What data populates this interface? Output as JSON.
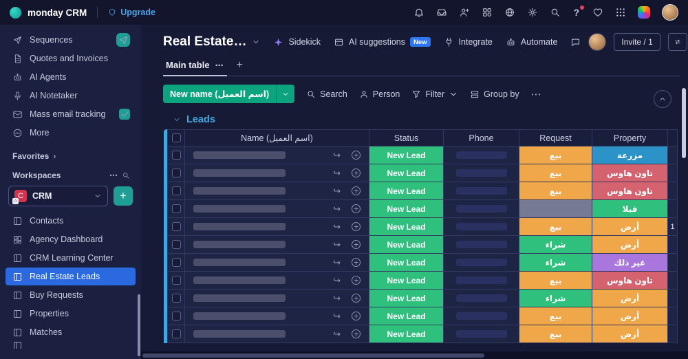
{
  "icons": {
    "more": "⋯",
    "plus": "+",
    "chevron_right": "›",
    "help": "?",
    "open_arrow": "↪"
  },
  "topbar": {
    "brand": "monday CRM",
    "upgrade_label": "Upgrade"
  },
  "sidebar": {
    "items": [
      "Sequences",
      "Quotes and Invoices",
      "AI Agents",
      "AI Notetaker",
      "Mass email tracking",
      "More"
    ],
    "favorites_label": "Favorites",
    "workspaces_label": "Workspaces",
    "workspace_name": "CRM",
    "workspace_items": [
      "Contacts",
      "Agency Dashboard",
      "CRM Learning Center",
      "Real Estate Leads",
      "Buy Requests",
      "Properties",
      "Matches"
    ],
    "selected_item": "Real Estate Leads"
  },
  "board": {
    "title": "Real Estate…",
    "actions": {
      "sidekick": "Sidekick",
      "ai_suggestions": "AI suggestions",
      "ai_badge": "New",
      "integrate": "Integrate",
      "automate": "Automate",
      "invite": "Invite / 1"
    },
    "tab": "Main table",
    "toolbar": {
      "new_item": "New name (اسم العميل)",
      "new_item_color": "#0ba47e",
      "search": "Search",
      "person": "Person",
      "filter": "Filter",
      "group_by": "Group by"
    },
    "group": {
      "name": "Leads",
      "color": "#45a7e2"
    }
  },
  "table": {
    "columns": [
      "Name (اسم العميل)",
      "Status",
      "Phone",
      "Request",
      "Property"
    ],
    "rows": [
      {
        "status": "New Lead",
        "status_color": "#30c07d",
        "request": "بيع",
        "request_color": "#f0a74a",
        "property": "مزرعة",
        "property_color": "#2c93c9",
        "extra": ""
      },
      {
        "status": "New Lead",
        "status_color": "#30c07d",
        "request": "بيع",
        "request_color": "#f0a74a",
        "property": "تاون هاوس",
        "property_color": "#d5636f",
        "extra": ""
      },
      {
        "status": "New Lead",
        "status_color": "#30c07d",
        "request": "بيع",
        "request_color": "#f0a74a",
        "property": "تاون هاوس",
        "property_color": "#d5636f",
        "extra": ""
      },
      {
        "status": "New Lead",
        "status_color": "#30c07d",
        "request": "",
        "request_color": "#767b93",
        "property": "فيلا",
        "property_color": "#30c07d",
        "extra": ""
      },
      {
        "status": "New Lead",
        "status_color": "#30c07d",
        "request": "بيع",
        "request_color": "#f0a74a",
        "property": "أرض",
        "property_color": "#f0a74a",
        "extra": "1"
      },
      {
        "status": "New Lead",
        "status_color": "#30c07d",
        "request": "شراء",
        "request_color": "#30c07d",
        "property": "أرض",
        "property_color": "#f0a74a",
        "extra": ""
      },
      {
        "status": "New Lead",
        "status_color": "#30c07d",
        "request": "شراء",
        "request_color": "#30c07d",
        "property": "غير ذلك",
        "property_color": "#a876dd",
        "extra": ""
      },
      {
        "status": "New Lead",
        "status_color": "#30c07d",
        "request": "بيع",
        "request_color": "#f0a74a",
        "property": "تاون هاوس",
        "property_color": "#d5636f",
        "extra": ""
      },
      {
        "status": "New Lead",
        "status_color": "#30c07d",
        "request": "شراء",
        "request_color": "#30c07d",
        "property": "أرض",
        "property_color": "#f0a74a",
        "extra": ""
      },
      {
        "status": "New Lead",
        "status_color": "#30c07d",
        "request": "بيع",
        "request_color": "#f0a74a",
        "property": "أرض",
        "property_color": "#f0a74a",
        "extra": ""
      },
      {
        "status": "New Lead",
        "status_color": "#30c07d",
        "request": "بيع",
        "request_color": "#f0a74a",
        "property": "أرض",
        "property_color": "#f0a74a",
        "extra": ""
      }
    ]
  }
}
